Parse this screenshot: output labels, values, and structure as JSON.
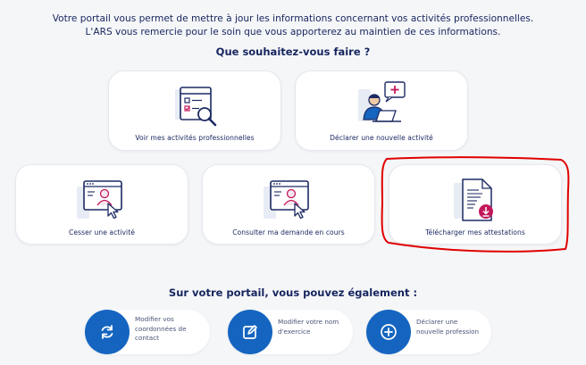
{
  "intro": {
    "line1": "Votre portail vous permet de mettre à jour les informations concernant vos activités professionnelles.",
    "line2": "L'ARS vous remercie pour le soin que vous apporterez au maintien de ces informations."
  },
  "question": "Que souhaitez-vous faire ?",
  "actions": {
    "voir": "Voir mes activités professionnelles",
    "declarer": "Déclarer une nouvelle activité",
    "cesser": "Cesser une activité",
    "consulter": "Consulter ma demande en cours",
    "telecharger": "Télécharger mes attestations"
  },
  "also": {
    "title": "Sur votre portail, vous pouvez également :",
    "coordonnees": "Modifier vos coordonnées de contact",
    "nom": "Modifier votre nom d'exercice",
    "profession": "Déclarer une nouvelle profession"
  },
  "colors": {
    "navy": "#16255e",
    "accent_blue": "#1565c0",
    "pink": "#c2185b",
    "annotation_red": "#e00000"
  },
  "icons": {
    "voir": "document-magnifier-icon",
    "declarer": "person-laptop-plus-icon",
    "cesser": "profile-window-cursor-icon",
    "consulter": "profile-window-cursor-icon",
    "telecharger": "document-download-icon",
    "coordonnees": "refresh-icon",
    "nom": "edit-icon",
    "profession": "plus-circle-icon"
  }
}
